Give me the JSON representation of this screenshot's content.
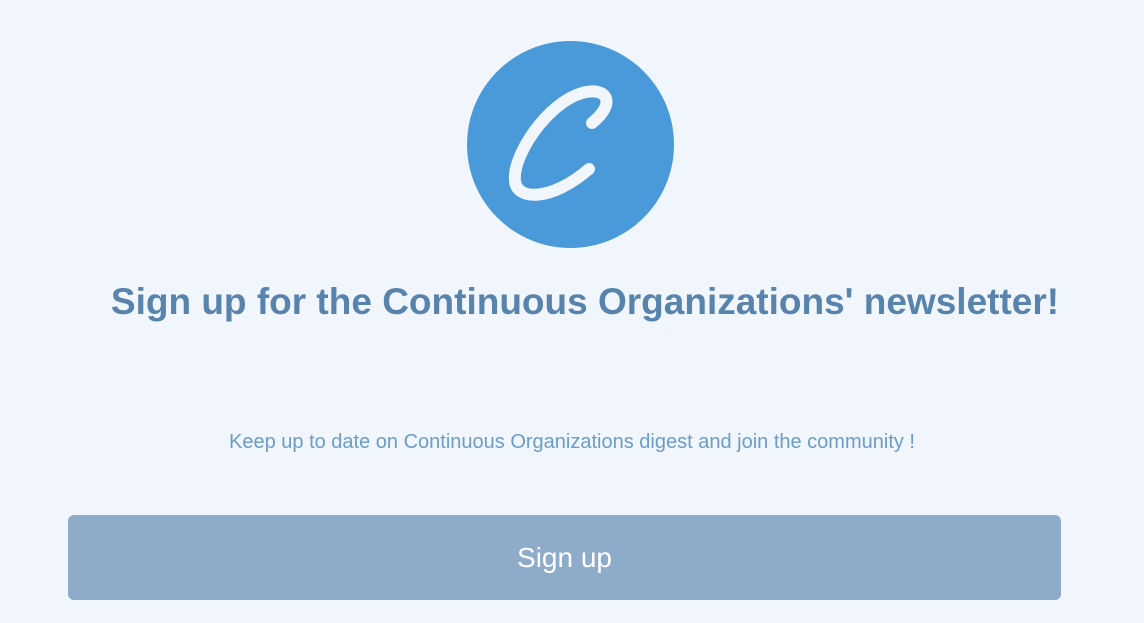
{
  "logo": {
    "icon": "continuous-organizations-c-logo",
    "background_color": "#4a99d8",
    "letter_color": "#f0f6fb"
  },
  "heading": {
    "title": "Sign up for the Continuous Organizations' newsletter!",
    "color": "#5783ad"
  },
  "description": {
    "text": "Keep up to date on Continuous Organizations digest and join the community !",
    "color": "#6d9cc8"
  },
  "signup": {
    "button_label": "Sign up",
    "button_color": "#8eacca"
  }
}
